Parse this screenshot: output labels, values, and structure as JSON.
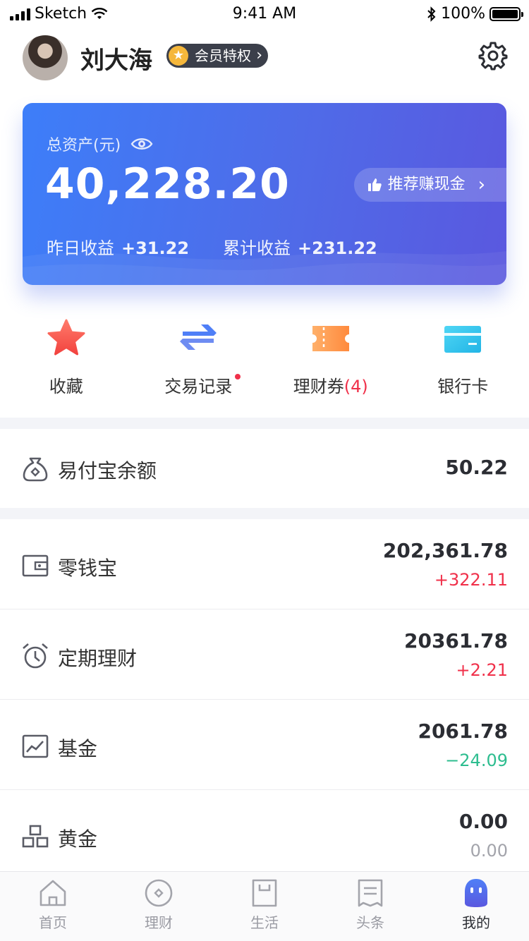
{
  "status_bar": {
    "carrier": "Sketch",
    "time": "9:41 AM",
    "battery": "100%"
  },
  "header": {
    "username": "刘大海",
    "vip_label": "会员特权"
  },
  "asset_card": {
    "label": "总资产(元)",
    "amount": "40,228.20",
    "refer_label": "推荐赚现金",
    "yesterday_label": "昨日收益",
    "yesterday_value": "+31.22",
    "total_label": "累计收益",
    "total_value": "+231.22"
  },
  "actions": {
    "favorites": "收藏",
    "records": "交易记录",
    "coupons": "理财券",
    "coupons_count": "(4)",
    "cards": "银行卡"
  },
  "balance": {
    "label": "易付宝余额",
    "value": "50.22"
  },
  "products": [
    {
      "name": "零钱宝",
      "value": "202,361.78",
      "change": "+322.11"
    },
    {
      "name": "定期理财",
      "value": "20361.78",
      "change": "+2.21"
    },
    {
      "name": "基金",
      "value": "2061.78",
      "change": "−24.09"
    },
    {
      "name": "黄金",
      "value": "0.00",
      "change": "0.00"
    }
  ],
  "colors": {
    "positive": "#f0304a",
    "negative": "#2dbd8f",
    "neutral": "#a3a4ab",
    "accent": "#4f6be8"
  },
  "tabs": [
    {
      "label": "首页",
      "icon": "home-icon"
    },
    {
      "label": "理财",
      "icon": "finance-icon"
    },
    {
      "label": "生活",
      "icon": "bag-icon"
    },
    {
      "label": "头条",
      "icon": "news-icon"
    },
    {
      "label": "我的",
      "icon": "me-icon",
      "active": true
    }
  ]
}
